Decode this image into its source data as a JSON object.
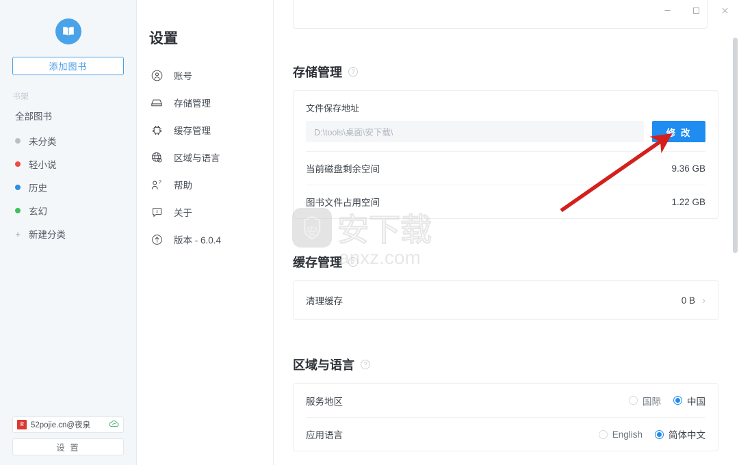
{
  "window": {
    "controls": [
      {
        "name": "minimize",
        "glyph": "—"
      },
      {
        "name": "maximize",
        "glyph": "□"
      },
      {
        "name": "close",
        "glyph": "✕"
      }
    ]
  },
  "sidebar": {
    "logo_icon": "open-book-icon",
    "add_book_label": "添加图书",
    "shelf_label": "书架",
    "all_books_label": "全部图书",
    "categories": [
      {
        "label": "未分类",
        "color": "#b9bfc6"
      },
      {
        "label": "轻小说",
        "color": "#f04a3f"
      },
      {
        "label": "历史",
        "color": "#2f8ee0"
      },
      {
        "label": "玄幻",
        "color": "#3fc05a"
      }
    ],
    "new_category_label": "新建分类",
    "account": {
      "name": "52pojie.cn@夜泉",
      "avatar_icon": "seal-avatar-icon",
      "sync_icon": "cloud-sync-icon",
      "sync_color": "#3fb06a"
    },
    "settings_button_label": "设 置"
  },
  "settings_nav": {
    "title": "设置",
    "items": [
      {
        "label": "账号",
        "icon": "user-circle-icon"
      },
      {
        "label": "存储管理",
        "icon": "hard-drive-icon"
      },
      {
        "label": "缓存管理",
        "icon": "chip-icon"
      },
      {
        "label": "区域与语言",
        "icon": "globe-icon"
      },
      {
        "label": "帮助",
        "icon": "user-question-icon"
      },
      {
        "label": "关于",
        "icon": "info-box-icon"
      },
      {
        "label": "版本 - 6.0.4",
        "icon": "update-arrow-icon"
      }
    ]
  },
  "content": {
    "storage": {
      "title": "存储管理",
      "help_icon": "question-circle-icon",
      "path_label": "文件保存地址",
      "path_value": "D:\\tools\\桌面\\安下载\\",
      "modify_button_label": "修 改",
      "rows": [
        {
          "label": "当前磁盘剩余空间",
          "value": "9.36 GB"
        },
        {
          "label": "图书文件占用空间",
          "value": "1.22 GB"
        }
      ]
    },
    "cache": {
      "title": "缓存管理",
      "help_icon": "question-circle-icon",
      "row": {
        "label": "清理缓存",
        "value": "0 B",
        "chevron_icon": "chevron-right-icon"
      }
    },
    "region": {
      "title": "区域与语言",
      "help_icon": "question-circle-icon",
      "service_region": {
        "label": "服务地区",
        "options": [
          {
            "label": "国际",
            "selected": false
          },
          {
            "label": "中国",
            "selected": true
          }
        ]
      },
      "app_language": {
        "label": "应用语言",
        "options": [
          {
            "label": "English",
            "selected": false
          },
          {
            "label": "简体中文",
            "selected": true
          }
        ]
      }
    }
  },
  "watermark": {
    "text_cn": "安下载",
    "text_en": "anxz.com",
    "shield_char": "安"
  },
  "annotation": {
    "arrow_color": "#d4201c",
    "points_at": "修 改"
  },
  "colors": {
    "accent": "#1e8cf1",
    "sidebar_bg": "#f4f7fa",
    "logo_bg": "#4aa3e8"
  }
}
